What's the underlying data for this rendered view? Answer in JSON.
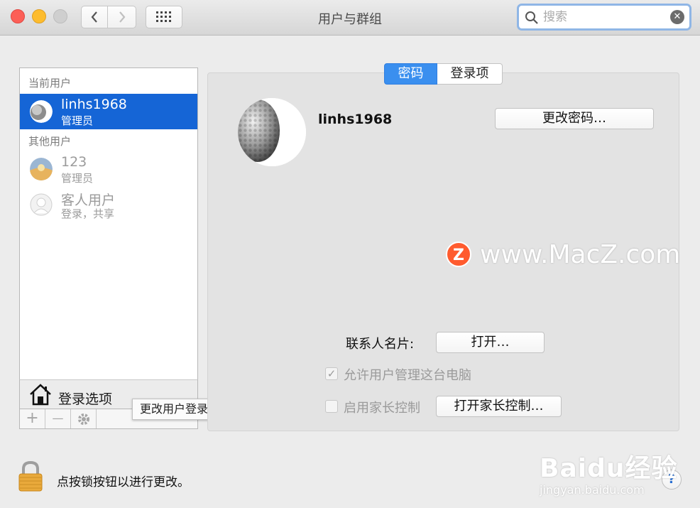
{
  "window": {
    "title": "用户与群组",
    "search_placeholder": "搜索"
  },
  "sidebar": {
    "current_users_label": "当前用户",
    "other_users_label": "其他用户",
    "current_user": {
      "name": "linhs1968",
      "role": "管理员"
    },
    "other_users": [
      {
        "name": "123",
        "role": "管理员"
      },
      {
        "name": "客人用户",
        "role": "登录，共享"
      }
    ],
    "login_options_label": "登录选项",
    "tooltip": "更改用户登录其帐户的方式",
    "add_symbol": "+",
    "remove_symbol": "—"
  },
  "main": {
    "tabs": [
      {
        "label": "密码"
      },
      {
        "label": "登录项"
      }
    ],
    "username": "linhs1968",
    "change_password_button": "更改密码…",
    "contact_card_label": "联系人名片:",
    "open_button": "打开…",
    "allow_admin_label": "允许用户管理这台电脑",
    "allow_admin_checked": true,
    "parental_controls_label": "启用家长控制",
    "parental_controls_checked": false,
    "open_parental_button": "打开家长控制…"
  },
  "footer": {
    "lock_text": "点按锁按钮以进行更改。",
    "help_label": "?"
  },
  "watermarks": {
    "macz_logo": "Z",
    "macz_text": "www.MacZ.com",
    "baidu_text": "Baidu经验",
    "baidu_url": "jingyan.baidu.com"
  },
  "colors": {
    "selection": "#1565d6",
    "tab_active": "#3a8fef",
    "search_focus": "#8fb6e6"
  }
}
